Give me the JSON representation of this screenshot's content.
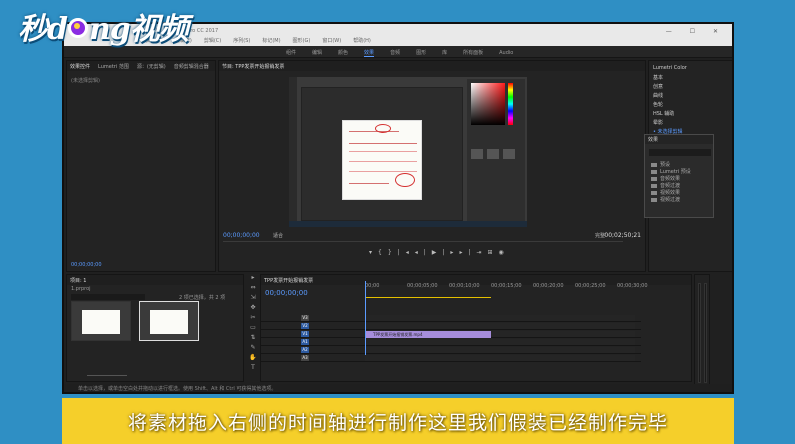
{
  "brand": {
    "logo_a": "秒d",
    "logo_b": "ng视频"
  },
  "window": {
    "title": "Adobe Premiere Pro CC 2017",
    "controls": "— ☐ ✕"
  },
  "menu": {
    "items": [
      "文件(F)",
      "编辑(E)",
      "剪辑(C)",
      "序列(S)",
      "标记(M)",
      "图形(G)",
      "窗口(W)",
      "帮助(H)"
    ]
  },
  "workspaces": {
    "tabs": [
      "组件",
      "编辑",
      "颜色",
      "效果",
      "音频",
      "图形",
      "库",
      "所有面板",
      "Audio"
    ],
    "active_index": 3
  },
  "source_panel": {
    "tabs": [
      "效果控件",
      "Lumetri 范围",
      "源：(无剪辑)",
      "音频剪辑混合器"
    ],
    "empty_text": "(未选择剪辑)",
    "footer_time": "00;00;00;00"
  },
  "program_panel": {
    "tab": "节目: TPP发票开始报销发票",
    "timecode_left": "00;00;00;00",
    "fit": "适合",
    "full": "完整",
    "timecode_right": "00;02;50;21",
    "transport": [
      "▾",
      "{",
      "}",
      "|◂",
      "◂|",
      "▶",
      "|▸",
      "▸|",
      "⇥",
      "⊞",
      "◉"
    ]
  },
  "lumetri_panel": {
    "items": [
      "Lumetri Color",
      "基本",
      "创意",
      "曲线",
      "色轮",
      "HSL 辅助",
      "晕影"
    ],
    "sub_item": "未选择剪辑"
  },
  "effects_panel": {
    "title": "效果",
    "folders": [
      "预设",
      "Lumetri 预设",
      "音频效果",
      "音频过渡",
      "视频效果",
      "视频过渡"
    ]
  },
  "project_panel": {
    "title": "项目: 1",
    "file": "1.prproj",
    "count": "2 项已选择，共 2 项",
    "search_placeholder": ""
  },
  "timeline": {
    "tab": "TPP发票开始报销发票",
    "timecode": "00;00;00;00",
    "ruler": [
      "00;00",
      "00;00;05;00",
      "00;00;10;00",
      "00;00;15;00",
      "00;00;20;00",
      "00;00;25;00",
      "00;00;30;00"
    ],
    "video_tracks": [
      "V3",
      "V2",
      "V1"
    ],
    "audio_tracks": [
      "A1",
      "A2",
      "A3"
    ],
    "clip_label": "TPP发票开始报销发票.mp4"
  },
  "tools": [
    "▸",
    "⇔",
    "⇲",
    "✥",
    "✂",
    "▭",
    "⇅",
    "✎",
    "✋",
    "T"
  ],
  "status": {
    "text": "单击以选择，或单击空白处并拖动以进行框选。使用 Shift、Alt 和 Ctrl 可获得其他选项。"
  },
  "caption": {
    "text": "将素材拖入右侧的时间轴进行制作这里我们假装已经制作完毕"
  }
}
